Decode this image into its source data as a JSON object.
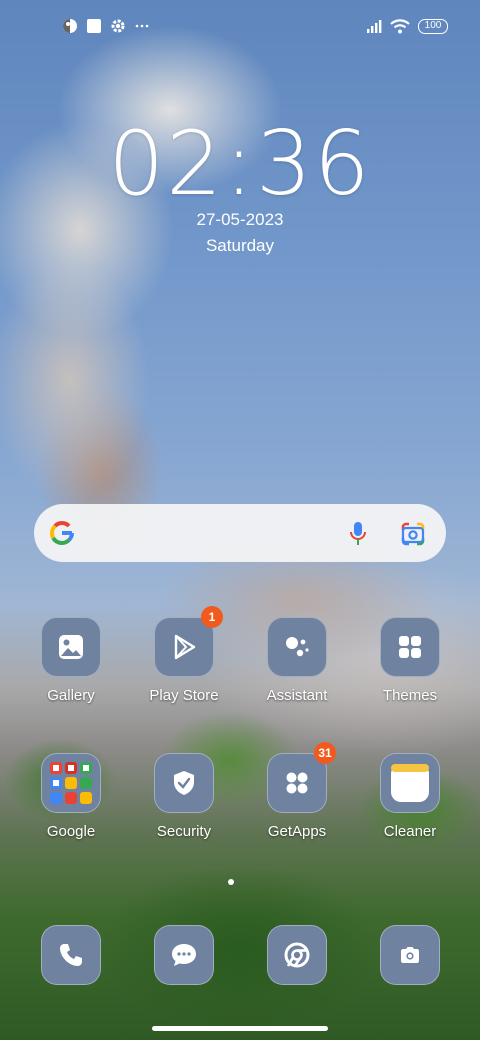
{
  "status_bar": {
    "icons_left": [
      "app-notification-icon",
      "square-notification-icon",
      "settings-gear-icon",
      "more-dots-icon"
    ],
    "icons_right": [
      "signal-icon",
      "wifi-icon"
    ],
    "battery": "100"
  },
  "clock": {
    "time": "02:36",
    "date": "27-05-2023",
    "day": "Saturday"
  },
  "search": {
    "logo": "google-g-icon",
    "mic": "microphone-icon",
    "lens": "google-lens-icon"
  },
  "apps": [
    {
      "label": "Gallery",
      "icon": "gallery-icon",
      "badge": ""
    },
    {
      "label": "Play Store",
      "icon": "play-store-icon",
      "badge": "1"
    },
    {
      "label": "Assistant",
      "icon": "assistant-icon",
      "badge": ""
    },
    {
      "label": "Themes",
      "icon": "themes-icon",
      "badge": ""
    },
    {
      "label": "Google",
      "icon": "google-folder-icon",
      "badge": ""
    },
    {
      "label": "Security",
      "icon": "security-shield-icon",
      "badge": ""
    },
    {
      "label": "GetApps",
      "icon": "getapps-icon",
      "badge": "31"
    },
    {
      "label": "Cleaner",
      "icon": "cleaner-icon",
      "badge": ""
    }
  ],
  "dock": [
    {
      "icon": "phone-icon"
    },
    {
      "icon": "messages-icon"
    },
    {
      "icon": "chrome-icon"
    },
    {
      "icon": "camera-icon"
    }
  ],
  "colors": {
    "tile": "#6f82a0",
    "badge": "#f25a1d",
    "search_bg": "#f2f2f4"
  }
}
